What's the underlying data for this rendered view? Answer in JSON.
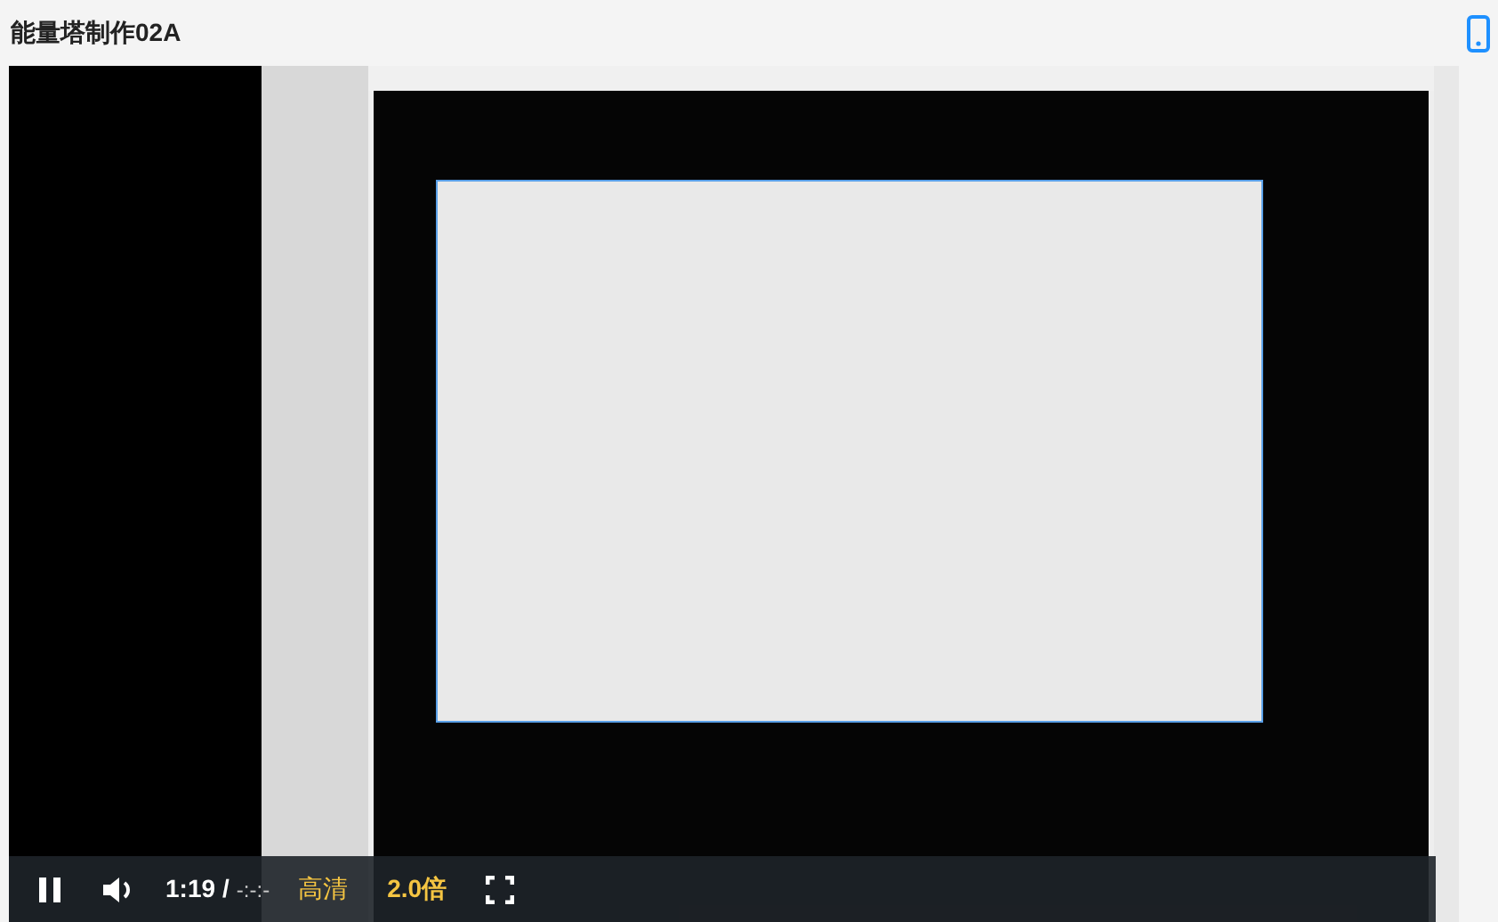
{
  "title": "能量塔制作02A",
  "player": {
    "playing": true,
    "current_time": "1:19",
    "separator": "/",
    "duration": "-:-:-",
    "quality": "高清",
    "speed": "2.0倍"
  }
}
